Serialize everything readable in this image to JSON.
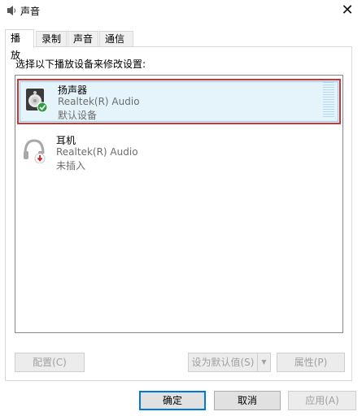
{
  "window": {
    "title": "声音",
    "close_glyph": "✕"
  },
  "tabs": [
    {
      "label": "播放",
      "active": true
    },
    {
      "label": "录制",
      "active": false
    },
    {
      "label": "声音",
      "active": false
    },
    {
      "label": "通信",
      "active": false
    }
  ],
  "panel": {
    "instruction": "选择以下播放设备来修改设置:",
    "devices": [
      {
        "name": "扬声器",
        "driver": "Realtek(R) Audio",
        "status": "默认设备",
        "selected": true,
        "badge": "check-icon"
      },
      {
        "name": "耳机",
        "driver": "Realtek(R) Audio",
        "status": "未插入",
        "selected": false,
        "badge": "unplugged-arrow-icon"
      }
    ],
    "buttons": {
      "configure": "配置(C)",
      "set_default": "设为默认值(S)",
      "properties": "属性(P)"
    }
  },
  "footer": {
    "ok": "确定",
    "cancel": "取消",
    "apply": "应用(A)"
  },
  "colors": {
    "selection_outline": "#cc3333",
    "primary_border": "#0078d7",
    "check_badge": "#2ea043"
  }
}
